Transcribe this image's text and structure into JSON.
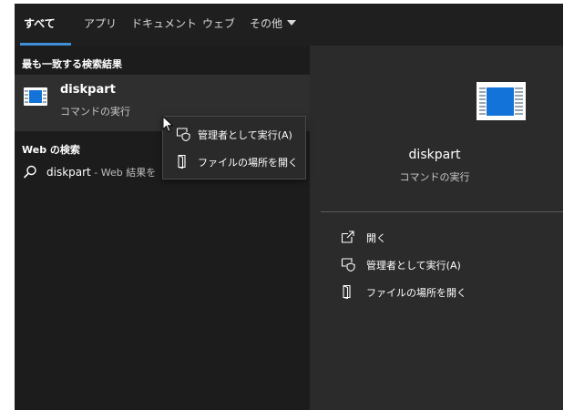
{
  "tabs": [
    {
      "label": "すべて"
    },
    {
      "label": "アプリ"
    },
    {
      "label": "ドキュメント"
    },
    {
      "label": "ウェブ"
    },
    {
      "label": "その他"
    }
  ],
  "best_match": {
    "title": "最も一致する検索結果",
    "app_name": "diskpart",
    "app_type": "コマンドの実行"
  },
  "web": {
    "title": "Web の検索",
    "query": "diskpart",
    "suffix": " - Web 結果を"
  },
  "context_menu": {
    "items": [
      {
        "label": "管理者として実行(A)",
        "icon": "run-as-admin-icon"
      },
      {
        "label": "ファイルの場所を開く",
        "icon": "open-file-location-icon"
      }
    ]
  },
  "preview": {
    "app_name": "diskpart",
    "app_type": "コマンドの実行",
    "actions": [
      {
        "label": "開く",
        "icon": "open-icon"
      },
      {
        "label": "管理者として実行(A)",
        "icon": "run-as-admin-icon"
      },
      {
        "label": "ファイルの場所を開く",
        "icon": "open-file-location-icon"
      }
    ]
  },
  "colors": {
    "accent": "#3e8ed8",
    "app_icon_blue": "#1473d8",
    "panel_bg": "#1c1c1c",
    "preview_bg": "#2b2b2b"
  }
}
